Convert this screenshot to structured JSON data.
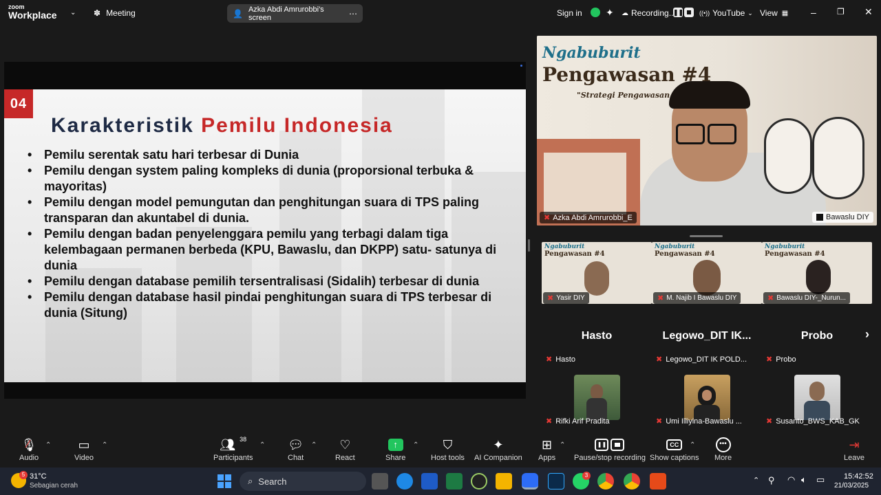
{
  "titlebar": {
    "logo_top": "zoom",
    "logo_bottom": "Workplace",
    "meeting_label": "Meeting",
    "share_label": "Azka Abdi Amrurobbi's screen",
    "signin": "Sign in",
    "recording": "Recording...",
    "youtube": "YouTube",
    "view": "View"
  },
  "slide": {
    "number": "04",
    "title_part1": "Karakteristik ",
    "title_part2": "Pemilu Indonesia",
    "bullets": [
      "Pemilu serentak satu hari terbesar di Dunia",
      "Pemilu dengan system paling kompleks di dunia (proporsional terbuka & mayoritas)",
      "Pemilu dengan model pemungutan dan penghitungan suara di TPS paling transparan dan akuntabel di dunia.",
      "Pemilu dengan badan penyelenggara pemilu yang terbagi dalam tiga kelembagaan permanen berbeda (KPU, Bawaslu, dan DKPP) satu- satunya di dunia",
      "Pemilu dengan database pemilih tersentralisasi (Sidalih) terbesar di dunia",
      "Pemilu dengan database hasil pindai penghitungan suara di TPS terbesar di dunia (Situng)"
    ]
  },
  "speaker": {
    "bg_title1": "Ngabuburit",
    "bg_title2": "Pengawasan #4",
    "bg_title3": "\"Strategi Pengawasan Partisi",
    "name": "Azka Abdi Amrurobbi_E",
    "org": "Bawaslu DIY"
  },
  "thumbs": [
    {
      "name": "Yasir DIY",
      "t1": "Ngabuburit",
      "t2": "Pengawasan #4"
    },
    {
      "name": "M. Najib I Bawaslu DIY",
      "t1": "Ngabuburit",
      "t2": "Pengawasan #4"
    },
    {
      "name": "Bawaslu DIY-_Nurun...",
      "t1": "Ngabuburit",
      "t2": "Pengawasan #4"
    }
  ],
  "name_tiles": [
    {
      "big": "Hasto",
      "small": "Hasto"
    },
    {
      "big": "Legowo_DIT IK...",
      "small": "Legowo_DIT IK POLD..."
    },
    {
      "big": "Probo",
      "small": "Probo"
    }
  ],
  "video_tiles": [
    {
      "name": "Rifki Arif Pradita"
    },
    {
      "name": "Umi Illiyina-Bawaslu ..."
    },
    {
      "name": "Susanto_BWS_KAB_GK"
    }
  ],
  "toolbar": {
    "audio": "Audio",
    "video": "Video",
    "participants": "Participants",
    "participants_count": "38",
    "chat": "Chat",
    "react": "React",
    "share": "Share",
    "host_tools": "Host tools",
    "ai_companion": "AI Companion",
    "apps": "Apps",
    "pause_recording": "Pause/stop recording",
    "show_captions": "Show captions",
    "more": "More",
    "leave": "Leave"
  },
  "taskbar": {
    "temp": "31°C",
    "weather": "Sebagian cerah",
    "weather_badge": "5",
    "search": "Search",
    "whatsapp_badge": "3",
    "time": "15:42:52",
    "date": "21/03/2025"
  },
  "colors": {
    "accent_red": "#c62828",
    "navy": "#1e2a44",
    "share_green": "#22c55e"
  }
}
